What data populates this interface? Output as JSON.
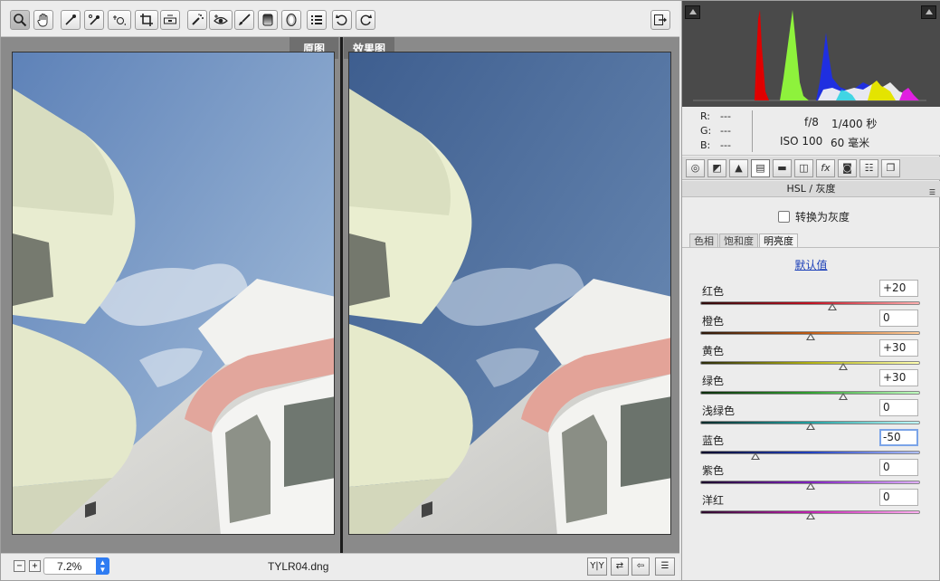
{
  "toolbar": {
    "tools": [
      {
        "name": "zoom-tool",
        "glyph": "🔍︎"
      },
      {
        "name": "hand-tool",
        "glyph": "✋︎"
      },
      {
        "name": "white-balance-tool",
        "glyph": "✎"
      },
      {
        "name": "color-sampler-tool",
        "glyph": "✐"
      },
      {
        "name": "targeted-adjustment-tool",
        "glyph": "⊕"
      },
      {
        "name": "crop-tool",
        "glyph": "⌗"
      },
      {
        "name": "straighten-tool",
        "glyph": "⊟"
      },
      {
        "name": "spot-removal-tool",
        "glyph": "∴"
      },
      {
        "name": "red-eye-tool",
        "glyph": "◉"
      },
      {
        "name": "adjustment-brush-tool",
        "glyph": "✏"
      },
      {
        "name": "graduated-filter-tool",
        "glyph": "▣"
      },
      {
        "name": "radial-filter-tool",
        "glyph": "⬯"
      },
      {
        "name": "preferences-tool",
        "glyph": "☰"
      },
      {
        "name": "rotate-left-tool",
        "glyph": "↺"
      },
      {
        "name": "rotate-right-tool",
        "glyph": "↻"
      },
      {
        "name": "toggle-fullscreen-tool",
        "glyph": "⇥"
      }
    ]
  },
  "preview": {
    "before_label": "原图",
    "after_label": "效果图"
  },
  "statusbar": {
    "zoom_value": "7.2%",
    "filename": "TYLR04.dng",
    "zoom_out": "−",
    "zoom_in": "+",
    "view_buttons": [
      "Y|Y",
      "⇄",
      "⇦",
      "☰"
    ]
  },
  "readout": {
    "r_label": "R:",
    "r_value": "---",
    "g_label": "G:",
    "g_value": "---",
    "b_label": "B:",
    "b_value": "---",
    "aperture": "f/8",
    "shutter": "1/400 秒",
    "iso": "ISO 100",
    "focal": "60 毫米"
  },
  "panel_tabs": [
    "◎",
    "◩",
    "▲",
    "▤",
    "▬",
    "◫",
    "fx",
    "◙",
    "☷",
    "❐"
  ],
  "panel": {
    "title": "HSL / 灰度",
    "convert_gray": "转换为灰度",
    "subtabs": [
      "色相",
      "饱和度",
      "明亮度"
    ],
    "default_link": "默认值",
    "sliders": [
      {
        "label": "红色",
        "value": "+20",
        "num": 20,
        "gradient": "linear-gradient(to right, #2a0a0a, #c01020, #ffb0b0)"
      },
      {
        "label": "橙色",
        "value": "0",
        "num": 0,
        "gradient": "linear-gradient(to right, #2a160a, #c05a10, #ffd0a0)"
      },
      {
        "label": "黄色",
        "value": "+30",
        "num": 30,
        "gradient": "linear-gradient(to right, #2a2a0a, #b0b010, #ffffb0)"
      },
      {
        "label": "绿色",
        "value": "+30",
        "num": 30,
        "gradient": "linear-gradient(to right, #0a2a0a, #30a030, #c0ffc0)"
      },
      {
        "label": "浅绿色",
        "value": "0",
        "num": 0,
        "gradient": "linear-gradient(to right, #0a2a2a, #20a0a0, #c0ffff)"
      },
      {
        "label": "蓝色",
        "value": "-50",
        "num": -50,
        "gradient": "linear-gradient(to right, #0a0a2a, #2040c0, #b0c0ff)"
      },
      {
        "label": "紫色",
        "value": "0",
        "num": 0,
        "gradient": "linear-gradient(to right, #1a0a2a, #8020c0, #e0b0ff)"
      },
      {
        "label": "洋红",
        "value": "0",
        "num": 0,
        "gradient": "linear-gradient(to right, #2a0a2a, #c020b0, #ffb0f0)"
      }
    ]
  },
  "colors": {
    "sky_before": "#86a3c8",
    "sky_after": "#4b6b99",
    "accent": "#2f7cf2"
  }
}
